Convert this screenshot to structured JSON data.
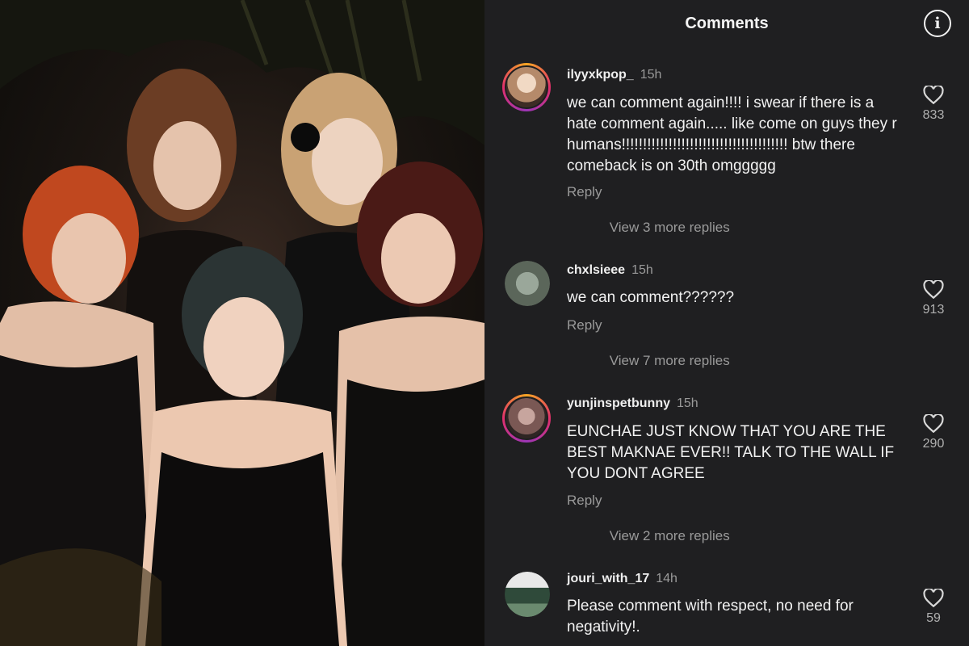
{
  "header": {
    "title": "Comments",
    "info_icon": "info-icon"
  },
  "photo": {
    "description_icon": "group-photo"
  },
  "comments": [
    {
      "username": "ilyyxkpop_",
      "time": "15h",
      "text": "we can comment again!!!! i swear if there is a hate comment again..... like come on guys they r humans!!!!!!!!!!!!!!!!!!!!!!!!!!!!!!!!!!!!!!! btw there comeback is on 30th omggggg",
      "reply_label": "Reply",
      "more_replies": "View 3 more replies",
      "likes": "833",
      "story_ring": true,
      "avatar_color": "#c9a88a"
    },
    {
      "username": "chxlsieee",
      "time": "15h",
      "text": "we can comment??????",
      "reply_label": "Reply",
      "more_replies": "View 7 more replies",
      "likes": "913",
      "story_ring": false,
      "avatar_color": "#6f7a6c"
    },
    {
      "username": "yunjinspetbunny",
      "time": "15h",
      "text": "EUNCHAE JUST KNOW THAT YOU ARE THE BEST MAKNAE EVER!! TALK TO THE WALL IF YOU DONT AGREE",
      "reply_label": "Reply",
      "more_replies": "View 2 more replies",
      "likes": "290",
      "story_ring": true,
      "avatar_color": "#8a6a66"
    },
    {
      "username": "jouri_with_17",
      "time": "14h",
      "text": "Please comment with respect, no need for negativity!.",
      "likes": "59",
      "story_ring": false,
      "avatar_color": "#4e6a55"
    }
  ],
  "colors": {
    "background": "#1f1f21",
    "muted_text": "#9a9a9a",
    "ring_gradient": "#e1306c"
  }
}
